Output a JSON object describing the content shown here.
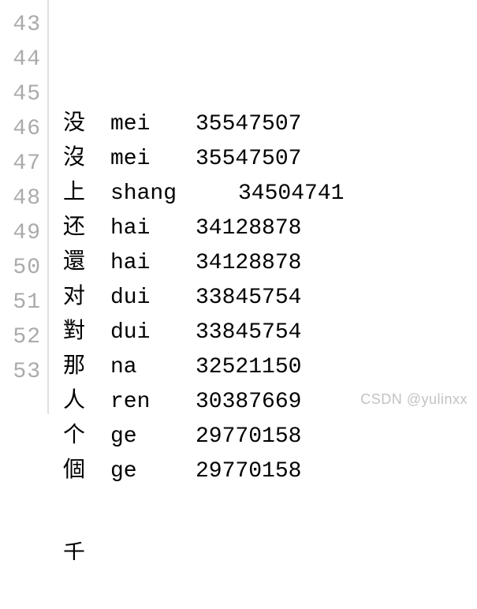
{
  "rows": [
    {
      "lineno": "43",
      "hanzi": "没",
      "pinyin": "mei",
      "wide": false,
      "value": "35547507"
    },
    {
      "lineno": "44",
      "hanzi": "沒",
      "pinyin": "mei",
      "wide": false,
      "value": "35547507"
    },
    {
      "lineno": "45",
      "hanzi": "上",
      "pinyin": "shang",
      "wide": true,
      "value": "34504741"
    },
    {
      "lineno": "46",
      "hanzi": "还",
      "pinyin": "hai",
      "wide": false,
      "value": "34128878"
    },
    {
      "lineno": "47",
      "hanzi": "還",
      "pinyin": "hai",
      "wide": false,
      "value": "34128878"
    },
    {
      "lineno": "48",
      "hanzi": "对",
      "pinyin": "dui",
      "wide": false,
      "value": "33845754"
    },
    {
      "lineno": "49",
      "hanzi": "對",
      "pinyin": "dui",
      "wide": false,
      "value": "33845754"
    },
    {
      "lineno": "50",
      "hanzi": "那",
      "pinyin": "na",
      "wide": false,
      "value": "32521150"
    },
    {
      "lineno": "51",
      "hanzi": "人",
      "pinyin": "ren",
      "wide": false,
      "value": "30387669"
    },
    {
      "lineno": "52",
      "hanzi": "个",
      "pinyin": "ge",
      "wide": false,
      "value": "29770158"
    },
    {
      "lineno": "53",
      "hanzi": "個",
      "pinyin": "ge",
      "wide": false,
      "value": "29770158"
    }
  ],
  "watermark": "CSDN @yulinxx"
}
